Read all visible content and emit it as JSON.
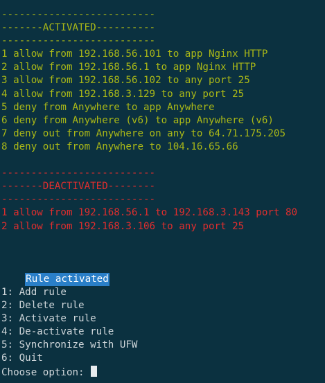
{
  "terminal": {
    "activated": {
      "separator_top": "--------------------------",
      "header": "-------ACTIVATED----------",
      "separator_bottom": "--------------------------",
      "rules": [
        "1 allow from 192.168.56.101 to app Nginx HTTP",
        "2 allow from 192.168.56.1 to app Nginx HTTP",
        "3 allow from 192.168.56.102 to any port 25",
        "4 allow from 192.168.3.129 to any port 25",
        "5 deny from Anywhere to app Anywhere",
        "6 deny from Anywhere (v6) to app Anywhere (v6)",
        "7 deny out from Anywhere on any to 64.71.175.205",
        "8 deny out from Anywhere to 104.16.65.66"
      ]
    },
    "deactivated": {
      "separator_top": "--------------------------",
      "header": "-------DEACTIVATED--------",
      "separator_bottom": "--------------------------",
      "rules": [
        "1 allow from 192.168.56.1 to 192.168.3.143 port 80",
        "2 allow from 192.168.3.106 to any port 25"
      ]
    },
    "status_message": "Rule activated",
    "menu": [
      "1: Add rule",
      "2: Delete rule",
      "3: Activate rule",
      "4: De-activate rule",
      "5: Synchronize with UFW",
      "6: Quit"
    ],
    "prompt": "Choose option: ",
    "colors": {
      "background": "#0b3140",
      "activated": "#aab817",
      "deactivated": "#df2e2e",
      "highlight": "#2a7fc8"
    }
  }
}
